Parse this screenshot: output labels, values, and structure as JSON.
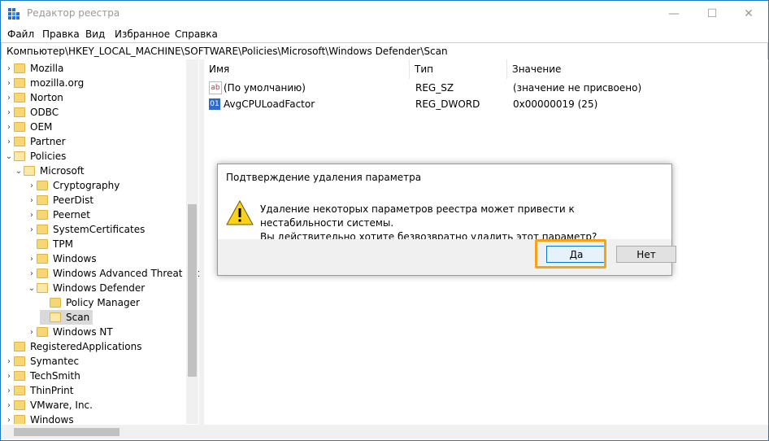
{
  "window": {
    "title": "Редактор реестра",
    "minimize": "—",
    "maximize": "☐",
    "close": "✕"
  },
  "menu": [
    "Файл",
    "Правка",
    "Вид",
    "Избранное",
    "Справка"
  ],
  "address": "Компьютер\\HKEY_LOCAL_MACHINE\\SOFTWARE\\Policies\\Microsoft\\Windows Defender\\Scan",
  "tree": [
    {
      "label": "Mozilla",
      "arrow": "›"
    },
    {
      "label": "mozilla.org",
      "arrow": "›"
    },
    {
      "label": "Norton",
      "arrow": "›"
    },
    {
      "label": "ODBC",
      "arrow": "›"
    },
    {
      "label": "OEM",
      "arrow": "›"
    },
    {
      "label": "Partner",
      "arrow": "›"
    },
    {
      "label": "Policies",
      "arrow": "⌄"
    },
    {
      "label": "Microsoft",
      "arrow": "⌄"
    },
    {
      "label": "Cryptography",
      "arrow": "›"
    },
    {
      "label": "PeerDist",
      "arrow": "›"
    },
    {
      "label": "Peernet",
      "arrow": "›"
    },
    {
      "label": "SystemCertificates",
      "arrow": "›"
    },
    {
      "label": "TPM",
      "arrow": ""
    },
    {
      "label": "Windows",
      "arrow": "›"
    },
    {
      "label": "Windows Advanced Threat Prc",
      "arrow": "›"
    },
    {
      "label": "Windows Defender",
      "arrow": "⌄"
    },
    {
      "label": "Policy Manager",
      "arrow": ""
    },
    {
      "label": "Scan",
      "arrow": ""
    },
    {
      "label": "Windows NT",
      "arrow": "›"
    },
    {
      "label": "RegisteredApplications",
      "arrow": ""
    },
    {
      "label": "Symantec",
      "arrow": "›"
    },
    {
      "label": "TechSmith",
      "arrow": "›"
    },
    {
      "label": "ThinPrint",
      "arrow": "›"
    },
    {
      "label": "VMware, Inc.",
      "arrow": "›"
    },
    {
      "label": "Windows",
      "arrow": "›"
    }
  ],
  "list": {
    "headers": {
      "name": "Имя",
      "type": "Тип",
      "value": "Значение"
    },
    "rows": [
      {
        "icon": "ab",
        "name": "(По умолчанию)",
        "type": "REG_SZ",
        "value": "(значение не присвоено)"
      },
      {
        "icon": "01",
        "name": "AvgCPULoadFactor",
        "type": "REG_DWORD",
        "value": "0x00000019 (25)"
      }
    ]
  },
  "dialog": {
    "title": "Подтверждение удаления параметра",
    "message_line1": "Удаление некоторых параметров реестра может привести к нестабильности системы.",
    "message_line2": "Вы действительно хотите безвозвратно удалить этот параметр?",
    "yes": "Да",
    "no": "Нет"
  },
  "colors": {
    "highlight": "#f4a21a",
    "folder": "#f7d675",
    "accent": "#0078d7"
  }
}
